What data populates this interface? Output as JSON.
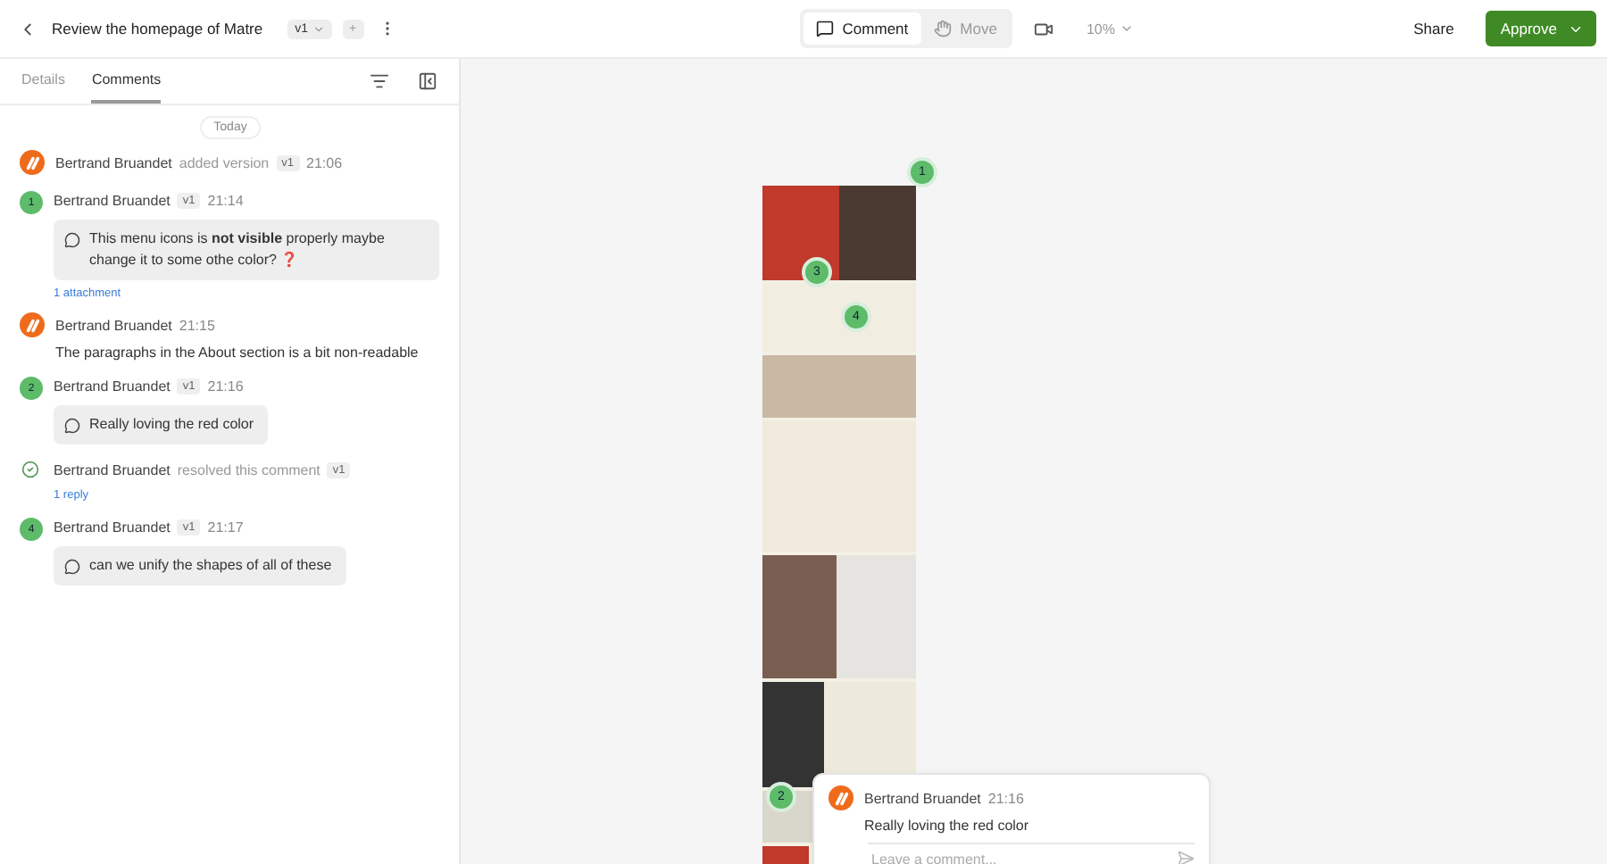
{
  "header": {
    "title": "Review the homepage of Matre",
    "version": "v1",
    "add_label": "+"
  },
  "tools": [
    {
      "label": "Comment",
      "selected": true
    },
    {
      "label": "Move",
      "selected": false
    }
  ],
  "zoom": "10%",
  "actions": {
    "share": "Share",
    "approve": "Approve"
  },
  "tabs": [
    {
      "label": "Details",
      "selected": false
    },
    {
      "label": "Comments",
      "selected": true
    }
  ],
  "day": "Today",
  "feed": [
    {
      "kind": "event",
      "author": "Bertrand Bruandet",
      "action": "added version",
      "version": "v1",
      "time": "21:06"
    },
    {
      "kind": "comment",
      "pin": "1",
      "author": "Bertrand Bruandet",
      "version": "v1",
      "time": "21:14",
      "text": "This menu icons is **not visible** properly maybe change it to some othe color? ❓",
      "link": "1 attachment"
    },
    {
      "kind": "note",
      "author": "Bertrand Bruandet",
      "time": "21:15",
      "text": "The paragraphs in the About section is a bit non-readable"
    },
    {
      "kind": "comment",
      "pin": "2",
      "author": "Bertrand Bruandet",
      "version": "v1",
      "time": "21:16",
      "text": "Really loving the red color"
    },
    {
      "kind": "resolved",
      "author": "Bertrand Bruandet",
      "action": "resolved this comment",
      "version": "v1",
      "link": "1 reply"
    },
    {
      "kind": "comment",
      "pin": "4",
      "author": "Bertrand Bruandet",
      "version": "v1",
      "time": "21:17",
      "text": "can we unify the shapes of all of these"
    }
  ],
  "pins": [
    {
      "label": "1"
    },
    {
      "label": "3"
    },
    {
      "label": "4"
    },
    {
      "label": "2"
    }
  ],
  "popup": {
    "author": "Bertrand Bruandet",
    "time": "21:16",
    "text": "Really loving the red color",
    "placeholder": "Leave a comment..."
  }
}
